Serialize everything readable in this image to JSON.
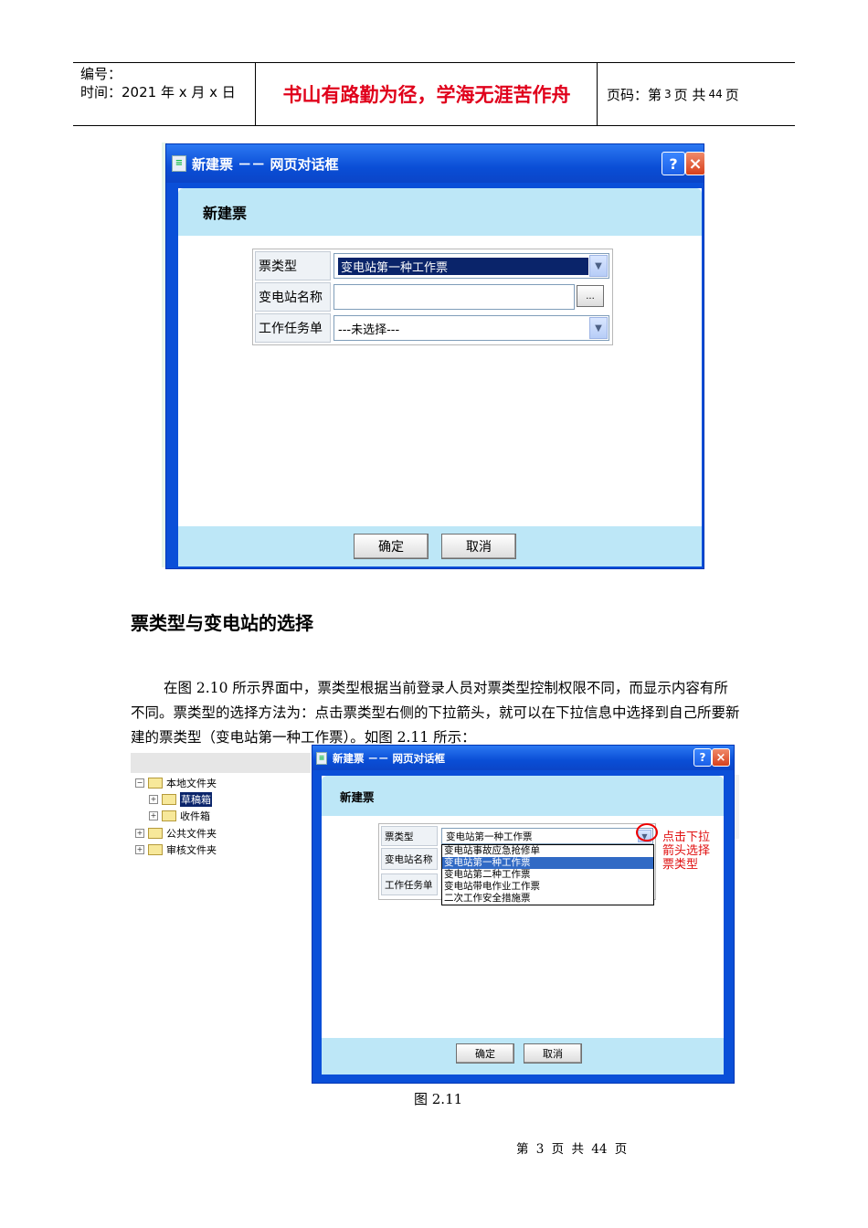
{
  "header": {
    "number_label": "编号：",
    "date_text": "时间：2021 年 x 月 x 日",
    "motto": "书山有路勤为径，学海无涯苦作舟",
    "page_prefix": "页码：第",
    "page_num": "3",
    "page_mid": "页  共",
    "page_total": "44",
    "page_suffix": "页"
  },
  "dialog1": {
    "title": "新建票 －－ 网页对话框",
    "help": "?",
    "close": "×",
    "panel_title": "新建票",
    "labels": {
      "ticket_type": "票类型",
      "station": "变电站名称",
      "task": "工作任务单"
    },
    "ticket_type_value": "变电站第一种工作票",
    "station_value": "",
    "browse": "...",
    "task_value": "---未选择---",
    "ok": "确定",
    "cancel": "取消"
  },
  "section_heading": "票类型与变电站的选择",
  "paragraph": "在图 2.10 所示界面中，票类型根据当前登录人员对票类型控制权限不同，而显示内容有所不同。票类型的选择方法为：点击票类型右侧的下拉箭头，就可以在下拉信息中选择到自己所要新建的票类型（变电站第一种工作票）。如图 2.11 所示：",
  "tree": {
    "items": [
      "本地文件夹",
      "草稿箱",
      "收件箱",
      "公共文件夹",
      "审核文件夹"
    ]
  },
  "dialog2": {
    "title": "新建票 －－ 网页对话框",
    "help": "?",
    "close": "×",
    "panel_title": "新建票",
    "labels": {
      "ticket_type": "票类型",
      "station": "变电站名称",
      "task": "工作任务单"
    },
    "ticket_type_value": "变电站第一种工作票",
    "options": [
      "变电站事故应急抢修单",
      "变电站第一种工作票",
      "变电站第二种工作票",
      "变电站带电作业工作票",
      "二次工作安全措施票"
    ],
    "selected_option_index": 1,
    "annotation": [
      "点击下拉",
      "箭头选择",
      "票类型"
    ],
    "ok": "确定",
    "cancel": "取消"
  },
  "figure_caption": "图 2.11",
  "footer": "第 3 页 共 44 页",
  "colors": {
    "motto": "#e0001b",
    "titlebar": "#0a4fd8",
    "panel": "#bde7f7",
    "annotation": "#e01010"
  }
}
